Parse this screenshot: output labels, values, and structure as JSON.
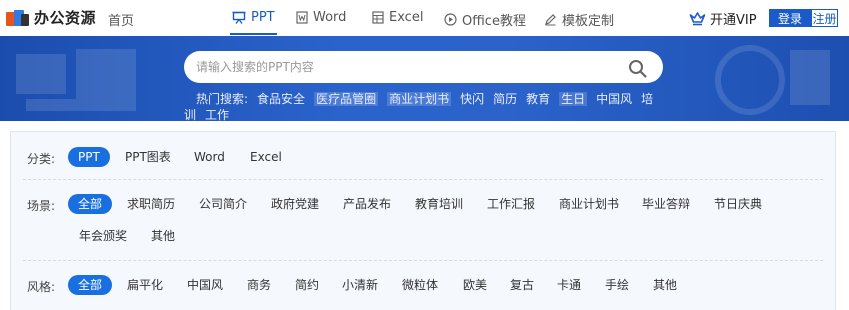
{
  "header": {
    "logo_text": "办公资源",
    "home": "首页",
    "tabs": [
      {
        "label": "PPT",
        "icon": "presentation-icon",
        "active": true
      },
      {
        "label": "Word",
        "icon": "word-doc-icon",
        "active": false
      },
      {
        "label": "Excel",
        "icon": "excel-table-icon",
        "active": false
      },
      {
        "label": "Office教程",
        "icon": "play-circle-icon",
        "active": false
      },
      {
        "label": "模板定制",
        "icon": "pen-icon",
        "active": false
      }
    ],
    "vip": "开通VIP",
    "login": "登录",
    "register": "注册"
  },
  "banner": {
    "search_placeholder": "请输入搜索的PPT内容",
    "hot_label": "热门搜索:",
    "hot_terms": [
      "食品安全",
      "医疗品管圈",
      "商业计划书",
      "快闪",
      "简历",
      "教育",
      "生日",
      "中国风",
      "培训",
      "工作"
    ]
  },
  "filters": {
    "category": {
      "label": "分类:",
      "options": [
        "PPT",
        "PPT图表",
        "Word",
        "Excel"
      ],
      "selected": "PPT"
    },
    "scene": {
      "label": "场景:",
      "options": [
        "全部",
        "求职简历",
        "公司简介",
        "政府党建",
        "产品发布",
        "教育培训",
        "工作汇报",
        "商业计划书",
        "毕业答辩",
        "节日庆典",
        "年会颁奖",
        "其他"
      ],
      "selected": "全部"
    },
    "style": {
      "label": "风格:",
      "options": [
        "全部",
        "扁平化",
        "中国风",
        "商务",
        "简约",
        "小清新",
        "微粒体",
        "欧美",
        "复古",
        "卡通",
        "手绘",
        "其他"
      ],
      "selected": "全部"
    }
  },
  "colors": {
    "brand_blue": "#1a5bc9",
    "active_pill": "#1a6fe0",
    "banner_blue": "#2a63cc"
  }
}
